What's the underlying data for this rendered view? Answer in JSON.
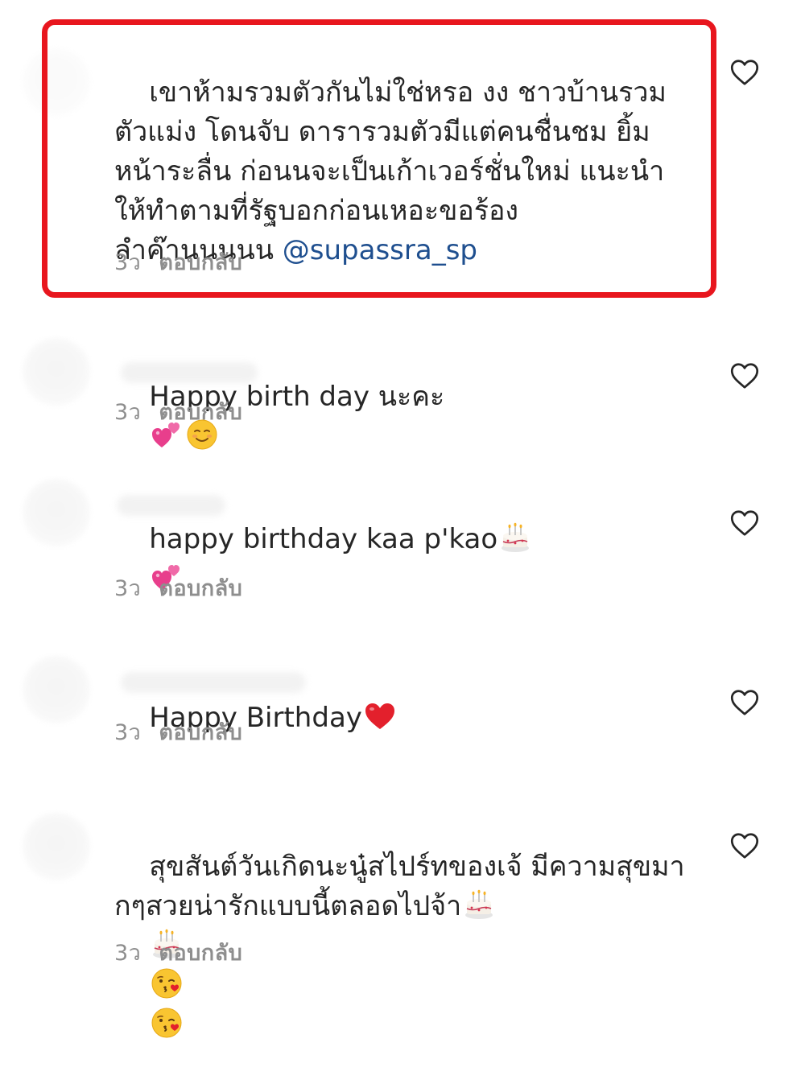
{
  "comments": [
    {
      "text_before": "เขาห้ามรวมตัวกันไม่ใช่หรอ งง ชาวบ้านรวมตัวแม่ง โดนจับ ดารารวมตัวมีแต่คนชื่นชม ยิ้มหน้าระลื่น ก่อนนจะเป็นเก้าเวอร์ชั่นใหม่ แนะนำ ให้ทำตามที่รัฐบอกก่อนเหอะขอร้อง ลำค๊านนนนน ",
      "mention": "@supassra_sp",
      "time": "3ว",
      "reply": "ตอบกลับ",
      "highlighted": true
    },
    {
      "text": "Happy birth day นะคะ",
      "emojis": [
        "two-hearts",
        "smiling-face"
      ],
      "time": "3ว",
      "reply": "ตอบกลับ"
    },
    {
      "text": "happy birthday kaa p'kao",
      "emojis": [
        "birthday-cake",
        "two-hearts"
      ],
      "time": "3ว",
      "reply": "ตอบกลับ"
    },
    {
      "text": "Happy Birthday",
      "emojis": [
        "red-heart"
      ],
      "time": "3ว",
      "reply": "ตอบกลับ"
    },
    {
      "text": "สุขสันต์วันเกิดนะนู๋สไปร์ทของเจ้ มีความสุขมากๆสวยน่ารักแบบนี้ตลอดไปจ้า",
      "emojis": [
        "birthday-cake",
        "birthday-cake",
        "face-blowing-kiss",
        "face-blowing-kiss"
      ],
      "time": "3ว",
      "reply": "ตอบกลับ"
    }
  ],
  "icons": {
    "like": "heart-outline-icon"
  },
  "colors": {
    "highlight_border": "#e8161e",
    "mention": "#1f4f8f",
    "meta": "#8e8e8e"
  }
}
